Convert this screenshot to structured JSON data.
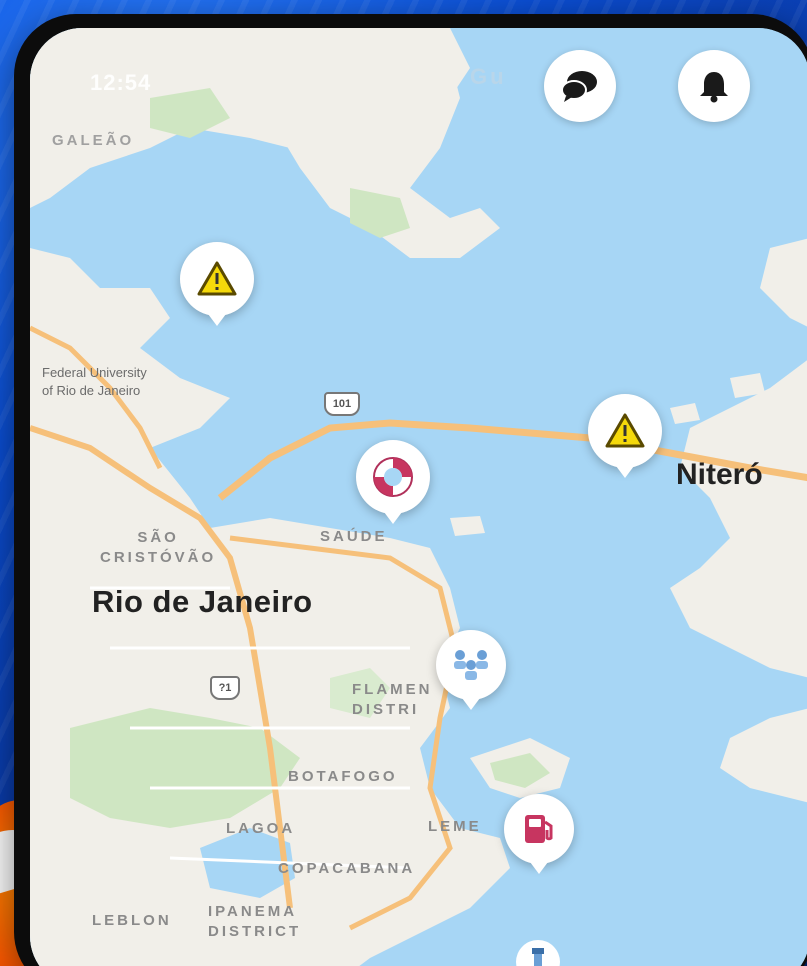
{
  "status_bar": {
    "time": "12:54"
  },
  "top_buttons": {
    "chat_icon": "chat-bubbles-icon",
    "notifications_icon": "bell-icon"
  },
  "labels": {
    "galeao": "GALEÃO",
    "guanabara": "Gu",
    "federal_university_line1": "Federal University",
    "federal_university_line2": "of Rio de Janeiro",
    "sao_cristovao_line1": "SÃO",
    "sao_cristovao_line2": "CRISTÓVÃO",
    "rio_de_janeiro": "Rio de Janeiro",
    "saude": "SAÚDE",
    "niteroi": "Niteró",
    "flamengo_line1": "FLAMEN",
    "flamengo_line2": "DISTRI",
    "botafogo": "BOTAFOGO",
    "lagoa": "LAGOA",
    "leme": "LEME",
    "copacabana": "COPACABANA",
    "leblon": "LEBLON",
    "ipanema_line1": "IPANEMA",
    "ipanema_line2": "DISTRICT"
  },
  "road_shields": {
    "br101": "101",
    "route_top": "101",
    "route_lower": "?1"
  },
  "pins": [
    {
      "kind": "hazard",
      "icon": "warning-triangle-icon"
    },
    {
      "kind": "hazard",
      "icon": "warning-triangle-icon"
    },
    {
      "kind": "rescue",
      "icon": "lifebuoy-icon"
    },
    {
      "kind": "event",
      "icon": "people-group-icon"
    },
    {
      "kind": "fuel",
      "icon": "fuel-pump-icon"
    }
  ],
  "colors": {
    "water": "#a7d6f5",
    "land": "#f1efe9",
    "park": "#cfe6c2",
    "road": "#f6c07a",
    "hazard": "#f5d90a"
  }
}
